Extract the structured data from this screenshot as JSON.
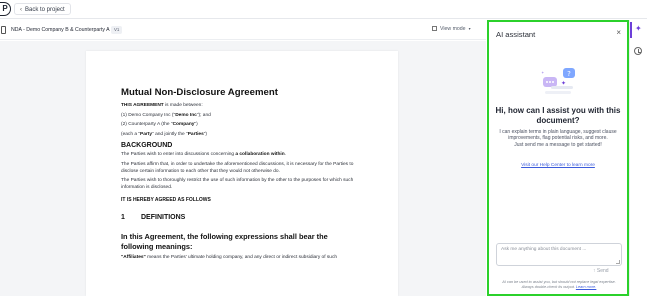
{
  "app": {
    "logo_letter": "P"
  },
  "topbar": {
    "back_label": "Back to project",
    "back_chevron": "‹"
  },
  "document": {
    "name": "NDA - Demo Company B & Counterparty A",
    "badge": "V1",
    "view_mode_label": "View mode",
    "view_mode_caret": "▾"
  },
  "agreement": {
    "title": "Mutual Non-Disclosure Agreement",
    "intro_bold": "THIS AGREEMENT",
    "intro_rest": " is made between:",
    "party1_prefix": "(1) Demo Company Inc (\"",
    "party1_bold": "Demo Inc",
    "party1_suffix": "\"); and",
    "party2_prefix": "(2) Counterparty A (the \"",
    "party2_bold": "Company",
    "party2_suffix": "\")",
    "parties_a": "(each a \"",
    "parties_b": "Party",
    "parties_c": "\" and jointly the \"",
    "parties_d": "Parties",
    "parties_e": "\")",
    "background_heading": "BACKGROUND",
    "bg1_a": "The Parties wish to enter into discussions concerning ",
    "bg1_b": "a collaboration within",
    "bg1_c": ".",
    "bg2": "The Parties affirm that, in order to undertake the aforementioned discussions, it is necessary for the Parties to disclose certain information to each other that they would not otherwise do.",
    "bg3": "The Parties wish to thoroughly restrict the use of such information by the other to the purposes for which such information is disclosed.",
    "agreed_heading": "IT IS HEREBY AGREED AS FOLLOWS",
    "section_number": "1",
    "section_title": "DEFINITIONS",
    "definitions_heading": "In this Agreement, the following expressions shall bear the following meanings:",
    "affiliates_bold": "\"Affiliates\"",
    "affiliates_rest": " means the Parties' ultimate holding company, and any direct or indirect subsidiary of such"
  },
  "ai_panel": {
    "title": "AI assistant",
    "close_glyph": "×",
    "heading": "Hi, how can I assist you with this document?",
    "description": "I can explain terms in plain language, suggest clause improvements, flag potential risks, and more.",
    "prompt": "Just send me a message to get started!",
    "help_link": "Visit our Help Center to learn more",
    "input_placeholder": "Ask me anything about this document ...",
    "send_label": "↑ Send",
    "disclaimer": "AI can be used to assist you, but should not replace legal expertise. Always double-check its output.",
    "disclaimer_link": "Learn more."
  },
  "rail": {
    "ai_glyph": "✦",
    "history_icon": "history-icon"
  },
  "colors": {
    "highlight": "#2bd12b",
    "accent": "#6d3fd9",
    "link": "#3b5bdb",
    "illustration_blue": "#7fa7ff"
  }
}
